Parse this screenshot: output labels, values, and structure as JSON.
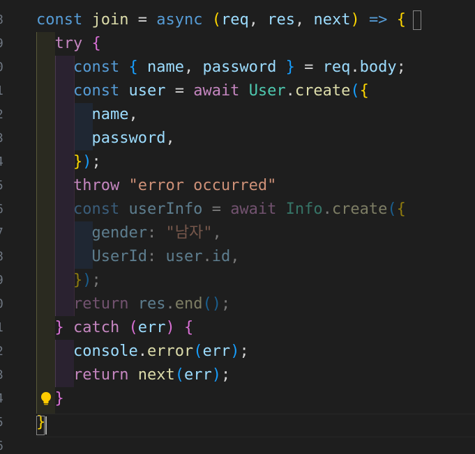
{
  "line_numbers": [
    "8",
    "9",
    "0",
    "1",
    "2",
    "3",
    "4",
    "5",
    "6",
    "7",
    "8",
    "9",
    "0",
    "1",
    "2",
    "3",
    "4",
    "5",
    "6"
  ],
  "code": {
    "l1": {
      "t1": "const",
      "t2": "join",
      "t3": "=",
      "t4": "async",
      "t5": "(",
      "t6": "req",
      "t7": ",",
      "t8": "res",
      "t9": ",",
      "t10": "next",
      "t11": ")",
      "t12": "=>",
      "t13": "{"
    },
    "l2": {
      "t1": "try",
      "t2": "{"
    },
    "l3": {
      "t1": "const",
      "t2": "{",
      "t3": "name",
      "t4": ",",
      "t5": "password",
      "t6": "}",
      "t7": "=",
      "t8": "req",
      "t9": ".",
      "t10": "body",
      "t11": ";"
    },
    "l4": {
      "t1": "const",
      "t2": "user",
      "t3": "=",
      "t4": "await",
      "t5": "User",
      "t6": ".",
      "t7": "create",
      "t8": "(",
      "t9": "{"
    },
    "l5": {
      "t1": "name",
      "t2": ","
    },
    "l6": {
      "t1": "password",
      "t2": ","
    },
    "l7": {
      "t1": "}",
      "t2": ")",
      "t3": ";"
    },
    "l8": {
      "t1": "throw",
      "t2": "\"error occurred\""
    },
    "l9": {
      "t1": "const",
      "t2": "userInfo",
      "t3": "=",
      "t4": "await",
      "t5": "Info",
      "t6": ".",
      "t7": "create",
      "t8": "(",
      "t9": "{"
    },
    "l10": {
      "t1": "gender",
      "t2": ":",
      "t3": "\"남자\"",
      "t4": ","
    },
    "l11": {
      "t1": "UserId",
      "t2": ":",
      "t3": "user",
      "t4": ".",
      "t5": "id",
      "t6": ","
    },
    "l12": {
      "t1": "}",
      "t2": ")",
      "t3": ";"
    },
    "l13": {
      "t1": "return",
      "t2": "res",
      "t3": ".",
      "t4": "end",
      "t5": "()",
      "t6": ";"
    },
    "l14": {
      "t1": "}",
      "t2": "catch",
      "t3": "(",
      "t4": "err",
      "t5": ")",
      "t6": "{"
    },
    "l15": {
      "t1": "console",
      "t2": ".",
      "t3": "error",
      "t4": "(",
      "t5": "err",
      "t6": ")",
      "t7": ";"
    },
    "l16": {
      "t1": "return",
      "t2": "next",
      "t3": "(",
      "t4": "err",
      "t5": ")",
      "t6": ";"
    },
    "l17": {
      "t1": "}"
    },
    "l18": {
      "t1": "}"
    }
  },
  "icons": {
    "lightbulb": "lightbulb-icon"
  },
  "colors": {
    "background": "#1e1e1e",
    "keyword": "#569cd6",
    "control": "#c586c0",
    "variable": "#9cdcfe",
    "function": "#dcdcaa",
    "class": "#4ec9b0",
    "string": "#ce9178",
    "bracket_gold": "#ffd700",
    "bracket_purple": "#da70d6",
    "bracket_blue": "#179fff"
  }
}
